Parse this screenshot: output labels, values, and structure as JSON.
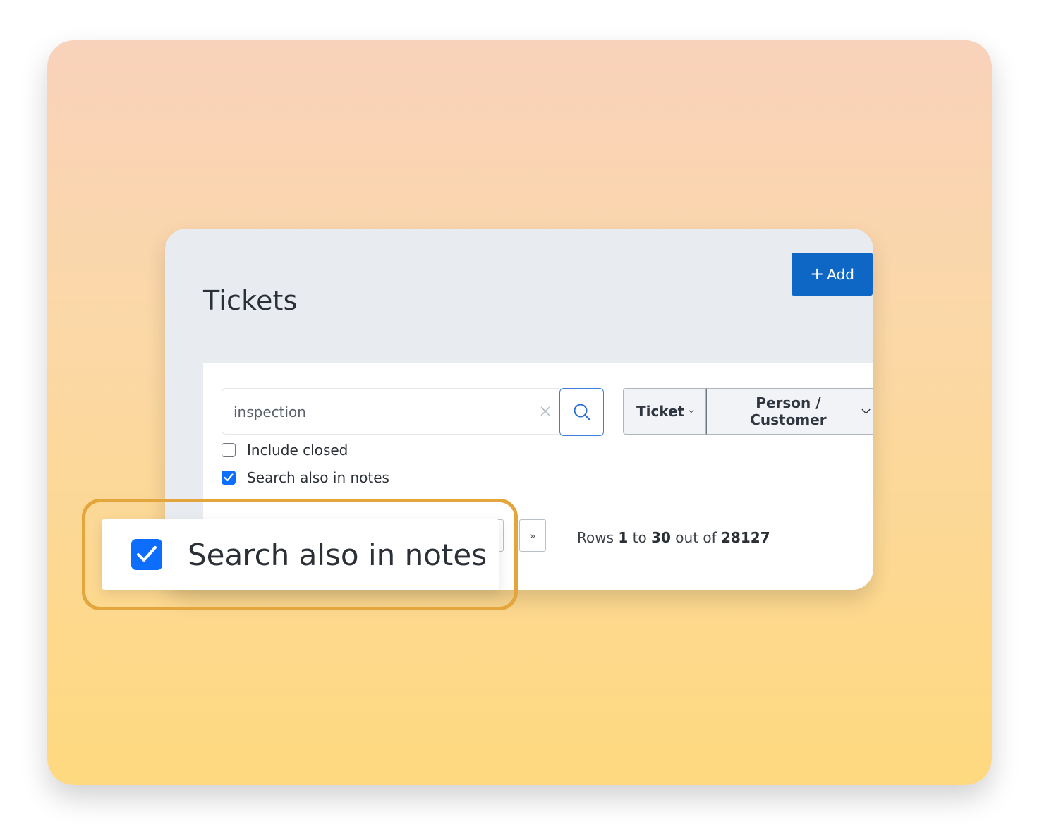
{
  "page": {
    "title": "Tickets",
    "add_label": "Add"
  },
  "search": {
    "value": "inspection",
    "placeholder": ""
  },
  "filters": {
    "ticket_label": "Ticket",
    "person_label": "Person / Customer"
  },
  "options": {
    "include_closed_label": "Include closed",
    "include_closed_checked": false,
    "search_notes_label": "Search also in notes",
    "search_notes_checked": true
  },
  "pagination": {
    "next_label": "»",
    "rows_prefix": "Rows",
    "rows_from": "1",
    "rows_to_word": "to",
    "rows_to": "30",
    "rows_out_of_word": "out of",
    "rows_total": "28127"
  },
  "callout": {
    "label": "Search also in notes",
    "checked": true
  },
  "colors": {
    "accent": "#0e67c5",
    "checkbox": "#0d6efd",
    "highlight": "#e3a53c"
  },
  "icons": {
    "add": "plus-icon",
    "clear": "close-icon",
    "search": "search-icon",
    "dropdown": "chevron-down-icon",
    "check": "check-icon"
  }
}
